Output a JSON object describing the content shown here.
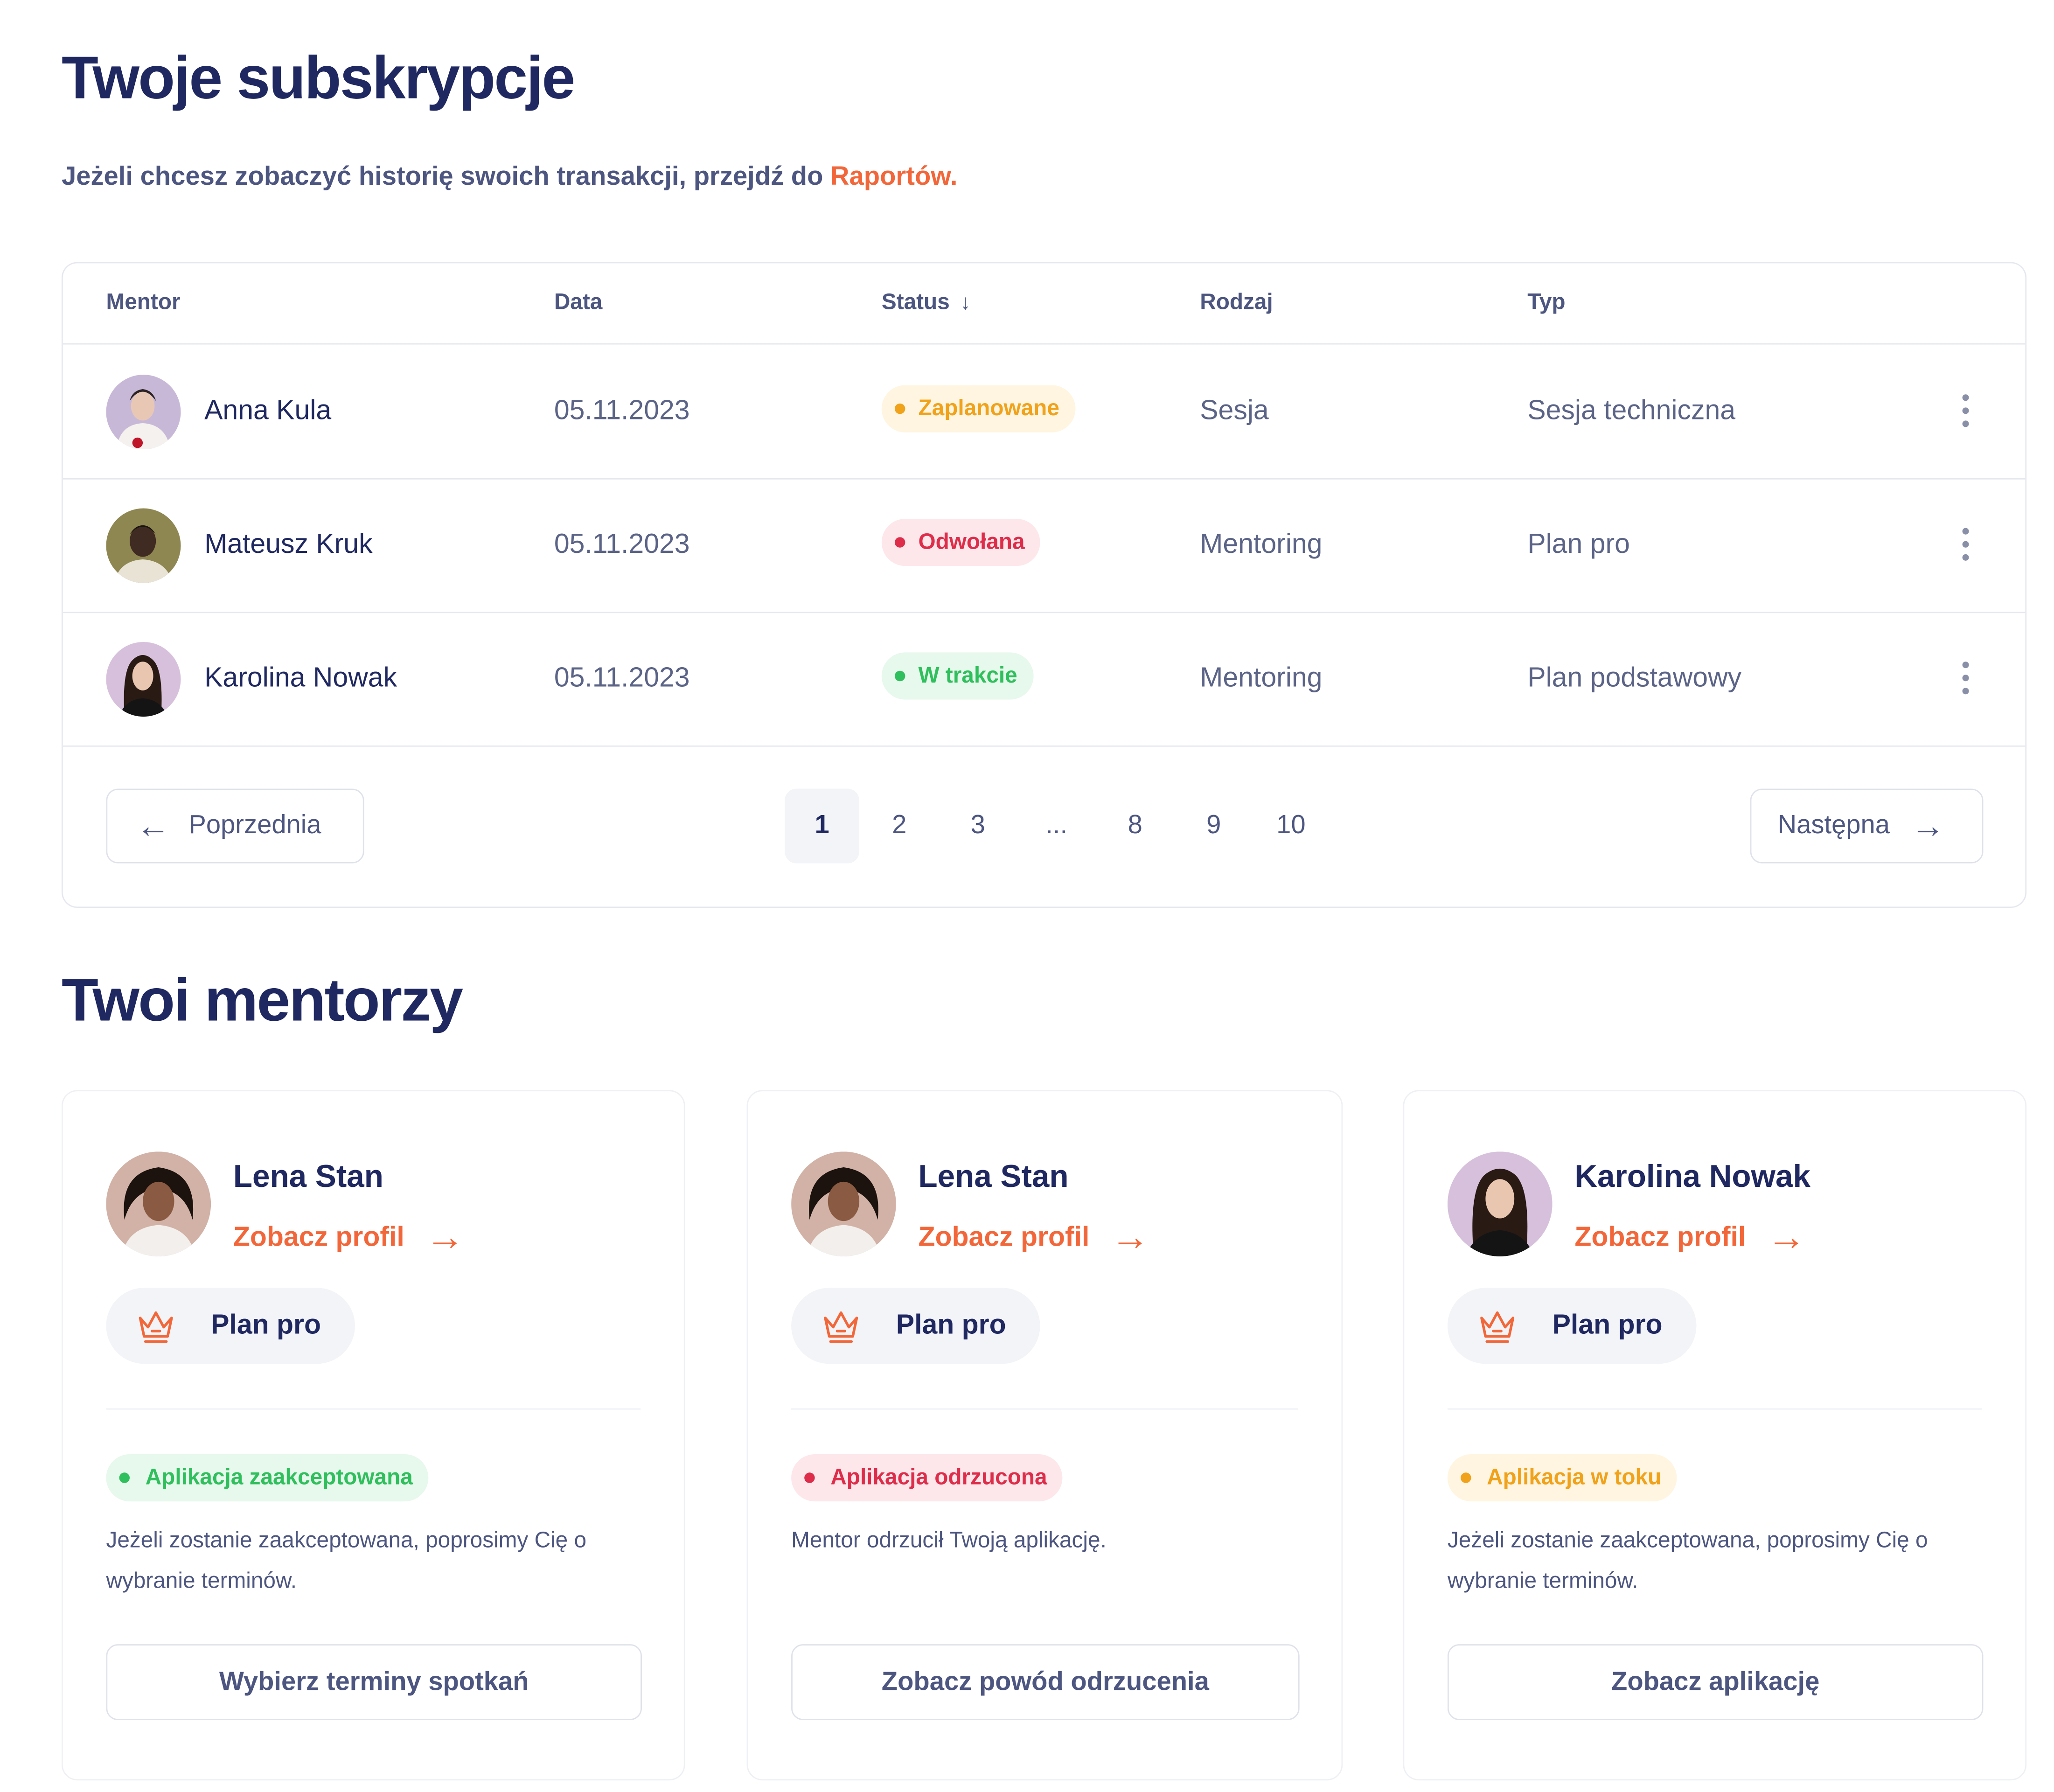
{
  "subscriptions": {
    "title": "Twoje subskrypcje",
    "intro_text": "Jeżeli chcesz zobaczyć historię swoich transakcji, przejdź do ",
    "intro_link": "Raportów.",
    "columns": {
      "mentor": "Mentor",
      "date": "Data",
      "status": "Status",
      "kind": "Rodzaj",
      "type": "Typ"
    },
    "rows": [
      {
        "name": "Anna Kula",
        "date": "05.11.2023",
        "status": "Zaplanowane",
        "status_color": "#f0a21a",
        "kind": "Sesja",
        "type": "Sesja techniczna"
      },
      {
        "name": "Mateusz Kruk",
        "date": "05.11.2023",
        "status": "Odwołana",
        "status_color": "#dd2d4a",
        "kind": "Mentoring",
        "type": "Plan pro"
      },
      {
        "name": "Karolina Nowak",
        "date": "05.11.2023",
        "status": "W trakcie",
        "status_color": "#2fbf5c",
        "kind": "Mentoring",
        "type": "Plan podstawowy"
      }
    ],
    "pagination": {
      "prev_label": "Poprzednia",
      "next_label": "Następna",
      "pages": [
        "1",
        "2",
        "3",
        "...",
        "8",
        "9",
        "10"
      ],
      "current_page": "1"
    }
  },
  "mentors": {
    "title": "Twoi mentorzy",
    "cards": [
      {
        "name": "Lena Stan",
        "profile_link": "Zobacz profil",
        "plan": "Plan pro",
        "status": "Aplikacja zaakceptowana",
        "status_color": "#2fbf5c",
        "description": "Jeżeli zostanie zaakceptowana, poprosimy Cię o wybranie terminów.",
        "button": "Wybierz terminy spotkań"
      },
      {
        "name": "Lena Stan",
        "profile_link": "Zobacz profil",
        "plan": "Plan pro",
        "status": "Aplikacja odrzucona",
        "status_color": "#dd2d4a",
        "description": "Mentor odrzucił Twoją aplikację.",
        "button": "Zobacz powód odrzucenia"
      },
      {
        "name": "Karolina Nowak",
        "profile_link": "Zobacz profil",
        "plan": "Plan pro",
        "status": "Aplikacja w toku",
        "status_color": "#f0a21a",
        "description": "Jeżeli zostanie zaakceptowana, poprosimy Cię o wybranie terminów.",
        "button": "Zobacz aplikację"
      }
    ]
  },
  "icons": {
    "sort": "arrow-down-icon",
    "row_menu": "more-vertical-icon",
    "prev": "arrow-left-icon",
    "next": "arrow-right-icon",
    "plan": "crown-icon"
  },
  "colors": {
    "heading": "#1f2860",
    "accent": "#f2673a",
    "text": "#4d5680",
    "border": "#e6e8ef"
  }
}
